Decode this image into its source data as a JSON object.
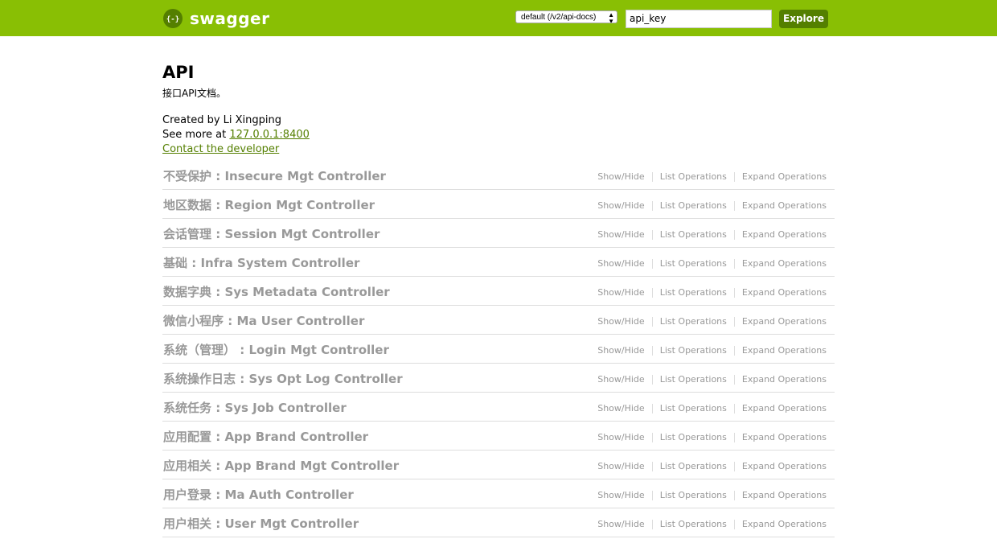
{
  "header": {
    "brand": "swagger",
    "logo_glyph": "{-}",
    "spec_select_value": "default (/v2/api-docs)",
    "api_key_value": "api_key",
    "explore_label": "Explore",
    "colors": {
      "header_bg": "#89bf04",
      "dark_green": "#547f00"
    }
  },
  "info": {
    "title": "API",
    "description": "接口API文档。",
    "created_by": "Created by Li Xingping",
    "see_more_prefix": "See more at ",
    "see_more_link": "127.0.0.1:8400",
    "contact": "Contact the developer"
  },
  "resources": [
    {
      "name": "不受保护 : Insecure Mgt Controller"
    },
    {
      "name": "地区数据 : Region Mgt Controller"
    },
    {
      "name": "会话管理 : Session Mgt Controller"
    },
    {
      "name": "基础 : Infra System Controller"
    },
    {
      "name": "数据字典 : Sys Metadata Controller"
    },
    {
      "name": "微信小程序 : Ma User Controller"
    },
    {
      "name": "系统（管理） : Login Mgt Controller"
    },
    {
      "name": "系统操作日志 : Sys Opt Log Controller"
    },
    {
      "name": "系统任务 : Sys Job Controller"
    },
    {
      "name": "应用配置 : App Brand Controller"
    },
    {
      "name": "应用相关 : App Brand Mgt Controller"
    },
    {
      "name": "用户登录 : Ma Auth Controller"
    },
    {
      "name": "用户相关 : User Mgt Controller"
    }
  ],
  "operations": {
    "show_hide": "Show/Hide",
    "list": "List Operations",
    "expand": "Expand Operations"
  }
}
